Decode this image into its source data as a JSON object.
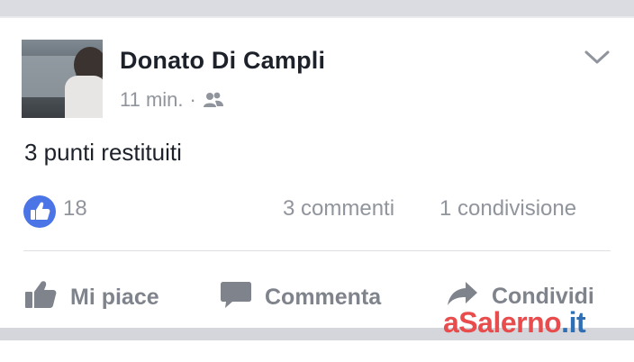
{
  "post": {
    "author": "Donato Di Campli",
    "time": "11 min.",
    "separator": "·",
    "text": "3 punti restituiti",
    "likes": "18",
    "comments": "3 commenti",
    "shares": "1 condivisione"
  },
  "actions": {
    "like": "Mi piace",
    "comment": "Commenta",
    "share": "Condividi"
  },
  "watermark": {
    "prefix": "aSalerno",
    "suffix": ".it"
  },
  "colors": {
    "like_blue": "#4b74e6",
    "muted_text": "#90949c",
    "watermark_red": "#e84c4c",
    "watermark_blue": "#2f6fb5"
  },
  "icons": [
    "friends-icon",
    "chevron-down-icon",
    "thumbs-up-icon",
    "comment-bubble-icon",
    "share-arrow-icon"
  ]
}
